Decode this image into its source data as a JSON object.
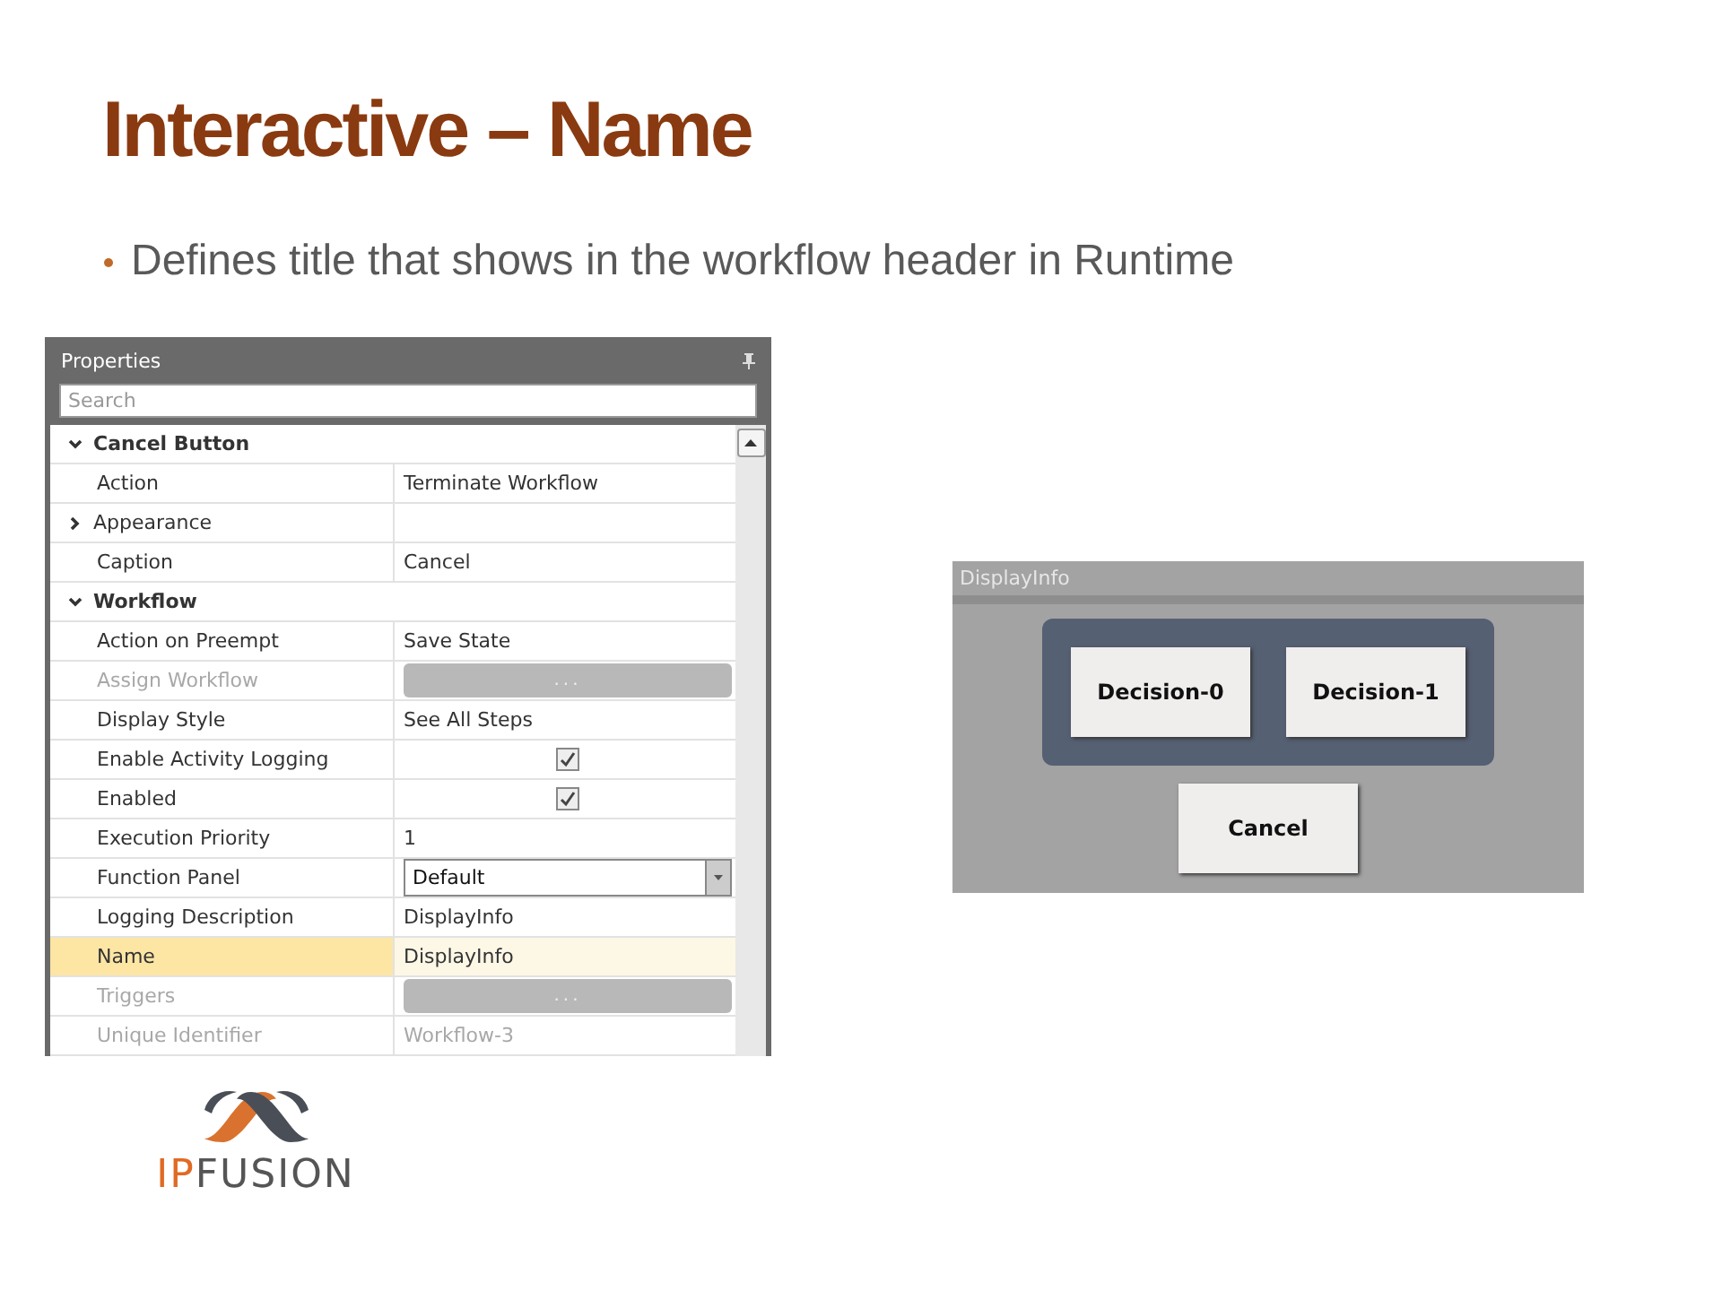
{
  "slide": {
    "title": "Interactive – Name",
    "bullets": [
      "Defines title that shows in the workflow header in Runtime"
    ]
  },
  "properties": {
    "title": "Properties",
    "search": {
      "placeholder": "Search"
    },
    "rows": [
      {
        "kind": "category",
        "label": "Cancel Button",
        "expanded": true
      },
      {
        "kind": "text",
        "label": "Action",
        "value": "Terminate Workflow",
        "disabled": false,
        "selected": false
      },
      {
        "kind": "group",
        "label": "Appearance",
        "expanded": false,
        "selected": false
      },
      {
        "kind": "text",
        "label": "Caption",
        "value": "Cancel",
        "disabled": false,
        "selected": false
      },
      {
        "kind": "category",
        "label": "Workflow",
        "expanded": true
      },
      {
        "kind": "text",
        "label": "Action on Preempt",
        "value": "Save State",
        "disabled": false,
        "selected": false
      },
      {
        "kind": "button",
        "label": "Assign Workflow",
        "value": "...",
        "disabled": true,
        "selected": false
      },
      {
        "kind": "text",
        "label": "Display Style",
        "value": "See All Steps",
        "disabled": false,
        "selected": false
      },
      {
        "kind": "checkbox",
        "label": "Enable Activity Logging",
        "checked": true,
        "disabled": false,
        "selected": false
      },
      {
        "kind": "checkbox",
        "label": "Enabled",
        "checked": true,
        "disabled": false,
        "selected": false
      },
      {
        "kind": "text",
        "label": "Execution Priority",
        "value": "1",
        "disabled": false,
        "selected": false
      },
      {
        "kind": "dropdown",
        "label": "Function Panel",
        "value": "Default",
        "disabled": false,
        "selected": false
      },
      {
        "kind": "text",
        "label": "Logging Description",
        "value": "DisplayInfo",
        "disabled": false,
        "selected": false
      },
      {
        "kind": "text",
        "label": "Name",
        "value": "DisplayInfo",
        "disabled": false,
        "selected": true
      },
      {
        "kind": "button",
        "label": "Triggers",
        "value": "...",
        "disabled": true,
        "selected": false
      },
      {
        "kind": "text",
        "label": "Unique Identifier",
        "value": "Workflow-3",
        "disabled": true,
        "selected": false
      }
    ]
  },
  "preview": {
    "title": "DisplayInfo",
    "decisions": [
      "Decision-0",
      "Decision-1"
    ],
    "cancel": "Cancel"
  },
  "logo": {
    "accent": "IP",
    "rest": "FUSION"
  }
}
